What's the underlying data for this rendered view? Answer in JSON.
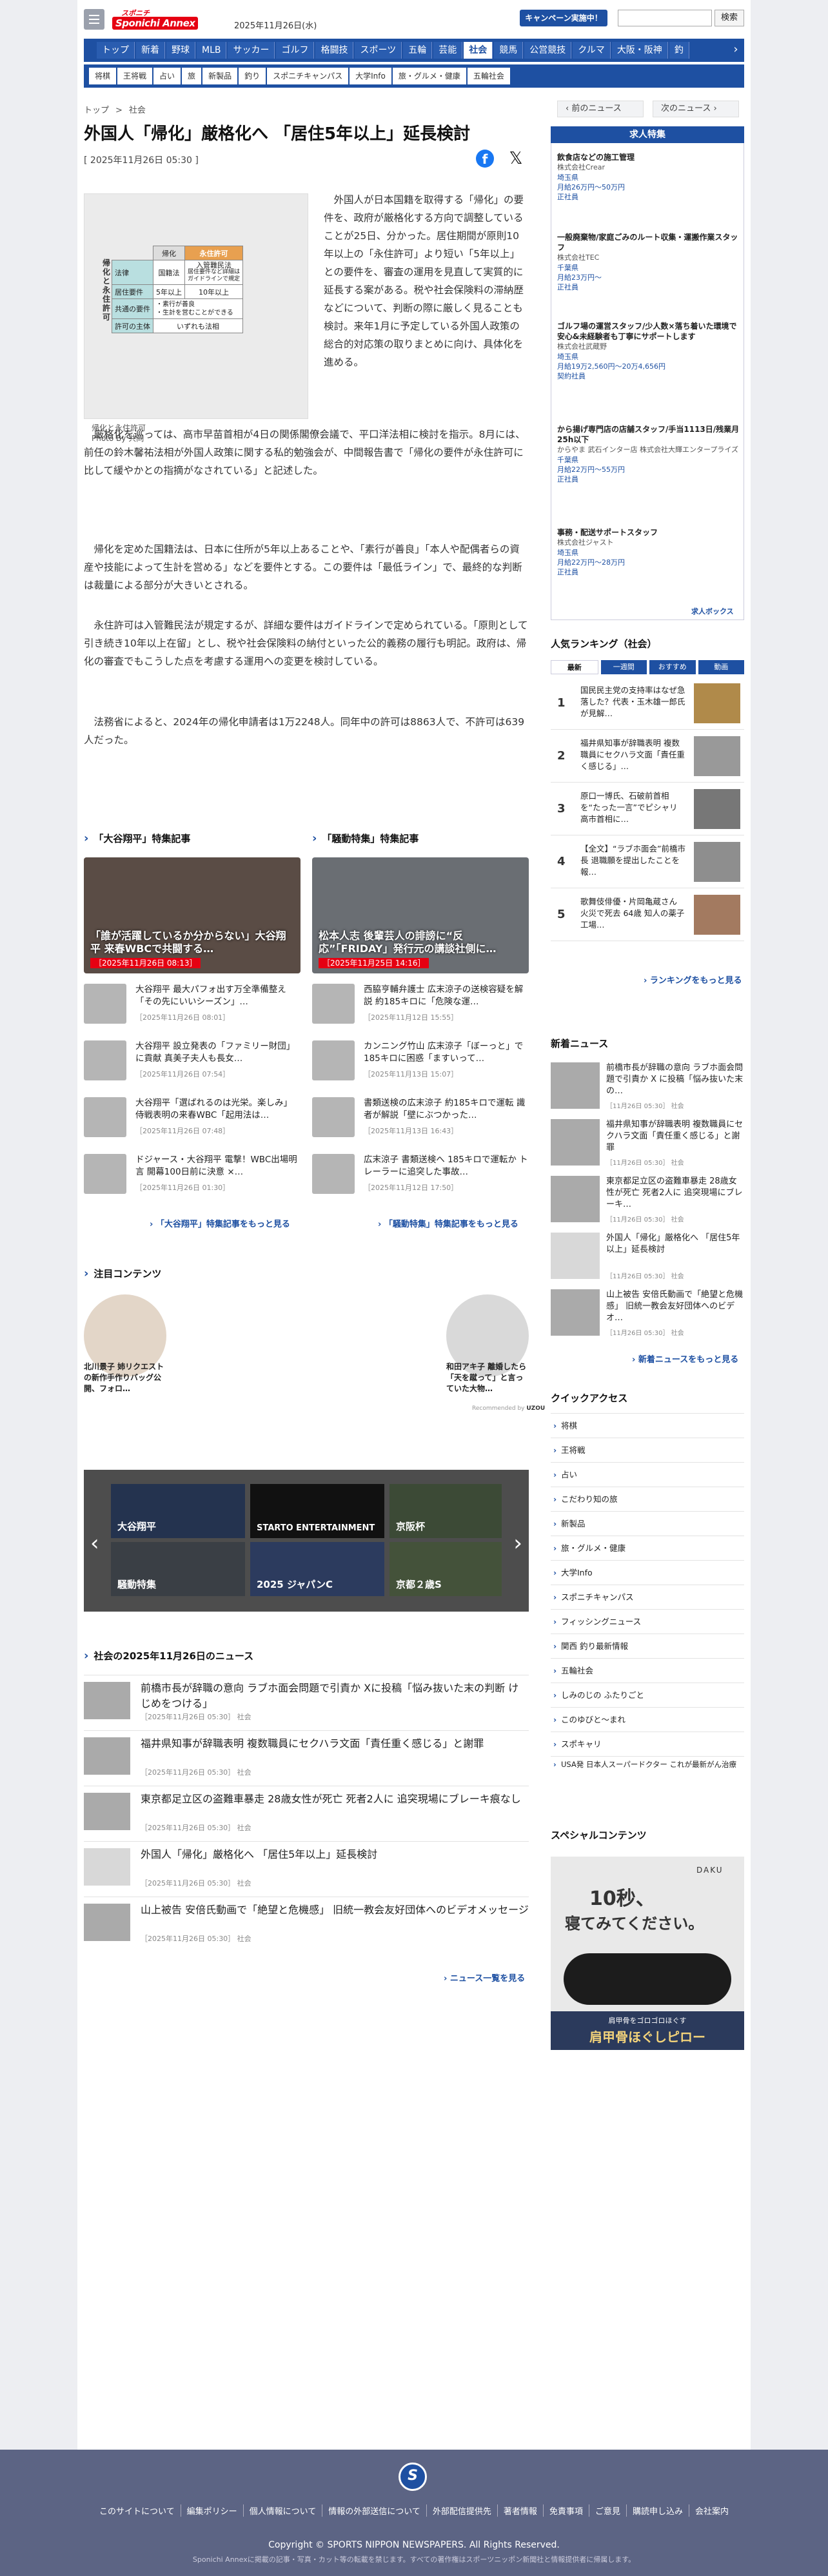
{
  "header": {
    "logo_top": "スポニチ",
    "logo_main": "Sponichi Annex",
    "date": "2025年11月26日(水)",
    "campaign": "キャンペーン実施中！",
    "search_button": "検索",
    "search_placeholder": ""
  },
  "nav": [
    "トップ",
    "新着",
    "野球",
    "MLB",
    "サッカー",
    "ゴルフ",
    "格闘技",
    "スポーツ",
    "五輪",
    "芸能",
    "社会",
    "競馬",
    "公営競技",
    "クルマ",
    "大阪・阪神",
    "釣"
  ],
  "subnav": [
    "将棋",
    "王将戦",
    "占い",
    "旅",
    "新製品",
    "釣り",
    "スポニチキャンパス",
    "大学Info",
    "旅・グルメ・健康",
    "五輪社会"
  ],
  "breadcrumb": [
    "トップ",
    "社会"
  ],
  "prev_label": "前のニュース",
  "next_label": "次のニュース",
  "article": {
    "title": "外国人「帰化」厳格化へ 「居住5年以上」延長検討",
    "date": "[ 2025年11月26日 05:30 ]",
    "caption": "帰化と永住許可",
    "credit": "Photo By 共同",
    "lead": "外国人が日本国籍を取得する「帰化」の要件を、政府が厳格化する方向で調整していることが25日、分かった。居住期間が原則10年以上の「永住許可」より短い「5年以上」との要件を、審査の運用を見直して実質的に延長する案がある。税や社会保険料の滞納歴などについて、判断の際に厳しく見ることも検討。来年1月に予定している外国人政策の総合的対応策の取りまとめに向け、具体化を進める。",
    "para2": "厳格化を巡っては、高市早苗首相が4日の関係閣僚会議で、平口洋法相に検討を指示。8月には、前任の鈴木馨祐法相が外国人政策に関する私的勉強会が、中間報告書で「帰化の要件が永住許可に比して緩やかとの指摘がなされている」と記述した。",
    "para3": "帰化を定めた国籍法は、日本に住所が5年以上あることや、「素行が善良」「本人や配偶者らの資産や技能によって生計を営める」などを要件とする。この要件は「最低ライン」で、最終的な判断は裁量による部分が大きいとされる。",
    "para4": "永住許可は入管難民法が規定するが、詳細な要件はガイドラインで定められている。「原則として引き続き10年以上在留」とし、税や社会保険料の納付といった公的義務の履行も明記。政府は、帰化の審査でもこうした点を考慮する運用への変更を検討している。",
    "para5": "法務省によると、2024年の帰化申請者は1万2248人。同年中の許可は8863人で、不許可は639人だった。",
    "table": {
      "side": "帰化と永住許可",
      "h_kika": "帰化",
      "h_eiju": "永住許可",
      "rows": [
        {
          "k": "法律",
          "a": "国籍法",
          "b": "入管難民法",
          "b2": "居住要件など詳細は\nガイドラインで規定"
        },
        {
          "k": "居住要件",
          "a": "5年以上",
          "b": "10年以上"
        },
        {
          "k": "共通の要件",
          "a": "・素行が善良\n・生計を営むことができる"
        },
        {
          "k": "許可の主体",
          "a": "いずれも法相"
        }
      ]
    }
  },
  "ohtani": {
    "heading": "「大谷翔平」特集記事",
    "feature_title": "「誰が活躍しているか分からない」大谷翔平 来春WBCで共闘する…",
    "feature_date": "［2025年11月26日 08:13］",
    "items": [
      {
        "t": "大谷翔平 最大パフォ出す万全準備整え「その先にいいシーズン」…",
        "d": "［2025年11月26日 08:01］"
      },
      {
        "t": "大谷翔平 設立発表の「ファミリー財団」に貢献 真美子夫人も長女…",
        "d": "［2025年11月26日 07:54］"
      },
      {
        "t": "大谷翔平「選ばれるのは光栄。楽しみ」侍戦表明の来春WBC「起用法は…",
        "d": "［2025年11月26日 07:48］"
      },
      {
        "t": "ドジャース・大谷翔平 電撃！WBC出場明言 開幕100日前に決意 ×…",
        "d": "［2025年11月26日 01:30］"
      }
    ],
    "more": "「大谷翔平」特集記事をもっと見る"
  },
  "souten": {
    "heading": "「騒動特集」特集記事",
    "feature_title": "松本人志 後輩芸人の誹謗に“反応”「FRIDAY」発行元の講談社側に…",
    "feature_date": "［2025年11月25日 14:16］",
    "items": [
      {
        "t": "西脇亨輔弁護士 広末涼子の送検容疑を解説 約185キロに「危険な運…",
        "d": "［2025年11月12日 15:55］"
      },
      {
        "t": "カンニング竹山 広末涼子「ぼーっと」で185キロに困惑「ますいって…",
        "d": "［2025年11月13日 15:07］"
      },
      {
        "t": "書類送検の広末涼子 約185キロで運転 識者が解説「壁にぶつかった…",
        "d": "［2025年11月13日 16:43］"
      },
      {
        "t": "広末涼子 書類送検へ 185キロで運転か トレーラーに追突した事故…",
        "d": "［2025年11月12日 17:50］"
      }
    ],
    "more": "「騒動特集」特集記事をもっと見る"
  },
  "promo": {
    "heading": "注目コンテンツ",
    "left": "北川景子 姉リクエストの新作手作りバッグ公開、フォロ…",
    "right": "和田アキ子 離婚したら「天を蹴って」と言っていた大物…",
    "badge": "Recommended by"
  },
  "carousel": [
    "大谷翔平",
    "STARTO ENTERTAINMENT",
    "京阪杯",
    "騒動特集",
    "2025 ジャパンC",
    "京都２歳S"
  ],
  "daily": {
    "heading": "社会の2025年11月26日のニュース",
    "items": [
      {
        "t": "前橋市長が辞職の意向 ラブホ面会問題で引責か Xに投稿「悩み抜いた末の判断 けじめをつける」",
        "d": "［2025年11月26日 05:30］ 社会"
      },
      {
        "t": "福井県知事が辞職表明 複数職員にセクハラ文面「責任重く感じる」と謝罪",
        "d": "［2025年11月26日 05:30］ 社会"
      },
      {
        "t": "東京都足立区の盗難車暴走 28歳女性が死亡 死者2人に 追突現場にブレーキ痕なし",
        "d": "［2025年11月26日 05:30］ 社会"
      },
      {
        "t": "外国人「帰化」厳格化へ 「居住5年以上」延長検討",
        "d": "［2025年11月26日 05:30］ 社会"
      },
      {
        "t": "山上被告 安倍氏動画で「絶望と危機感」 旧統一教会友好団体へのビデオメッセージ",
        "d": "［2025年11月26日 05:30］ 社会"
      }
    ],
    "more": "ニュース一覧を見る"
  },
  "jobs": {
    "heading": "求人特集",
    "items": [
      {
        "a": "飲食店などの施工管理",
        "b": "株式会社Crear",
        "c": "埼玉県\n月給26万円〜50万円\n正社員"
      },
      {
        "a": "一般廃棄物/家庭ごみのルート収集・運搬作業スタッフ",
        "b": "株式会社TEC",
        "c": "千葉県\n月給23万円〜\n正社員"
      },
      {
        "a": "ゴルフ場の運営スタッフ/少人数×落ち着いた環境で安心&未経験者も丁寧にサポートします",
        "b": "株式会社武蔵野",
        "c": "埼玉県\n月給19万2,560円〜20万4,656円\n契約社員"
      },
      {
        "a": "から揚げ専門店の店舗スタッフ/手当1113日/残業月25h以下",
        "b": "からやま 武石インター店 株式会社大輝エンタープライズ",
        "c": "千葉県\n月給22万円〜55万円\n正社員"
      },
      {
        "a": "事務・配送サポートスタッフ",
        "b": "株式会社ジャスト",
        "c": "埼玉県\n月給22万円〜28万円\n正社員"
      }
    ],
    "logo": "求人ボックス"
  },
  "ranking": {
    "heading": "人気ランキング（社会）",
    "tabs": [
      "最新",
      "一週間",
      "おすすめ",
      "動画"
    ],
    "items": [
      {
        "n": "1",
        "t": "国民民主党の支持率はなぜ急落した？代表・玉木雄一郎氏が見解…"
      },
      {
        "n": "2",
        "t": "福井県知事が辞職表明 複数職員にセクハラ文面「責任重く感じる」…"
      },
      {
        "n": "3",
        "t": "原口一博氏、石破前首相を“たった一言”でピシャリ 高市首相に…"
      },
      {
        "n": "4",
        "t": "【全文】“ラブホ面会”前橋市長 退職願を提出したことを報…"
      },
      {
        "n": "5",
        "t": "歌舞伎俳優・片岡亀蔵さん 火災で死去 64歳 知人の薬子工場…"
      }
    ],
    "more": "ランキングをもっと見る"
  },
  "newest": {
    "heading": "新着ニュース",
    "items": [
      {
        "t": "前橋市長が辞職の意向 ラブホ面会問題で引責か X に投稿「悩み抜いた末の…",
        "d": "［11月26日 05:30］ 社会"
      },
      {
        "t": "福井県知事が辞職表明 複数職員にセクハラ文面「責任重く感じる」と謝罪",
        "d": "［11月26日 05:30］ 社会"
      },
      {
        "t": "東京都足立区の盗難車暴走 28歳女性が死亡 死者2人に 追突現場にブレーキ…",
        "d": "［11月26日 05:30］ 社会"
      },
      {
        "t": "外国人「帰化」厳格化へ 「居住5年以上」延長検討",
        "d": "［11月26日 05:30］ 社会"
      },
      {
        "t": "山上被告 安倍氏動画で「絶望と危機感」 旧統一教会友好団体へのビデオ…",
        "d": "［11月26日 05:30］ 社会"
      }
    ],
    "more": "新着ニュースをもっと見る"
  },
  "quick": {
    "heading": "クイックアクセス",
    "items": [
      "将棋",
      "王将戦",
      "占い",
      "こだわり知の旅",
      "新製品",
      "旅・グルメ・健康",
      "大学Info",
      "スポニチキャンパス",
      "フィッシングニュース",
      "関西 釣り最新情報",
      "五輪社会",
      "しみのじの ふたりごと",
      "このゆびと〜まれ",
      "スポキャリ",
      "USA発 日本人スーパードクター これが最新がん治療"
    ]
  },
  "special": {
    "heading": "スペシャルコンテンツ",
    "ad_brand": "DAKU",
    "ad_big": "10秒、",
    "ad_big2": "寝てみてください。",
    "ad_small": "肩甲骨をゴロゴロほぐす",
    "ad_bottom": "肩甲骨ほぐしピロー"
  },
  "footer": {
    "links": [
      "このサイトについて",
      "編集ポリシー",
      "個人情報について",
      "情報の外部送信について",
      "外部配信提供先",
      "著者情報",
      "免責事項",
      "ご意見",
      "購読申し込み",
      "会社案内"
    ],
    "copyright": "Copyright © SPORTS NIPPON NEWSPAPERS. All Rights Reserved.",
    "note": "Sponichi Annexに掲載の記事・写真・カット等の転載を禁じます。すべての著作権はスポーツニッポン新聞社と情報提供者に帰属します。",
    "logo": "S"
  },
  "colors": {
    "brand": "#1e50a2",
    "accent": "#e60012"
  }
}
